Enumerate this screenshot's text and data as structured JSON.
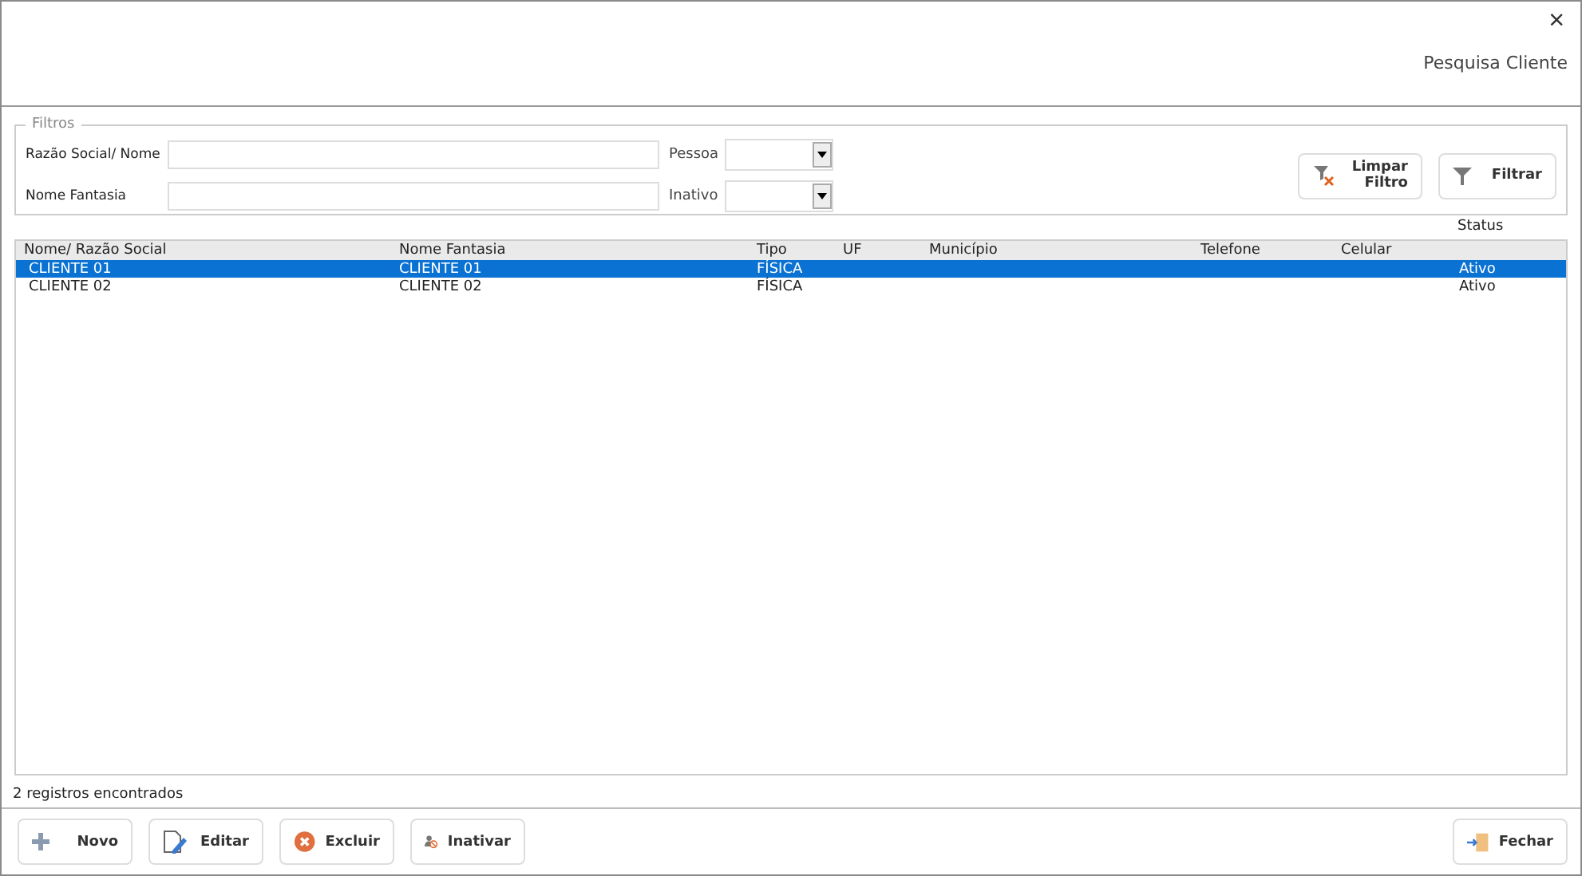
{
  "window": {
    "title": "Pesquisa Cliente",
    "close": "×"
  },
  "filters": {
    "legend": "Filtros",
    "fields": [
      {
        "label": "Razão Social/ Nome",
        "select_label": "Pessoa"
      },
      {
        "label": "Nome Fantasia",
        "select_label": "Inativo"
      }
    ],
    "buttons": [
      {
        "kind": "clear",
        "label": "Limpar Filtro"
      },
      {
        "kind": "filter",
        "label": "Filtrar"
      }
    ]
  },
  "table": {
    "columns": [
      "Nome/ Razão Social",
      "Nome Fantasia",
      "Tipo",
      "UF",
      "Município",
      "Telefone",
      "Celular",
      "Status"
    ],
    "rows": [
      {
        "cells": [
          "CLIENTE 01",
          "CLIENTE 01",
          "FÍSICA",
          "",
          "",
          "",
          "",
          "Ativo"
        ],
        "selected": true
      },
      {
        "cells": [
          "CLIENTE 02",
          "CLIENTE 02",
          "FÍSICA",
          "",
          "",
          "",
          "",
          "Ativo"
        ],
        "selected": false
      }
    ]
  },
  "status_bar": "2 registros encontrados",
  "actions": [
    {
      "kind": "new",
      "label": "Novo"
    },
    {
      "kind": "edit",
      "label": "Editar"
    },
    {
      "kind": "delete",
      "label": "Excluir"
    },
    {
      "kind": "deactivate",
      "label": "Inativar"
    }
  ],
  "close_button": {
    "kind": "close",
    "label": "Fechar"
  }
}
